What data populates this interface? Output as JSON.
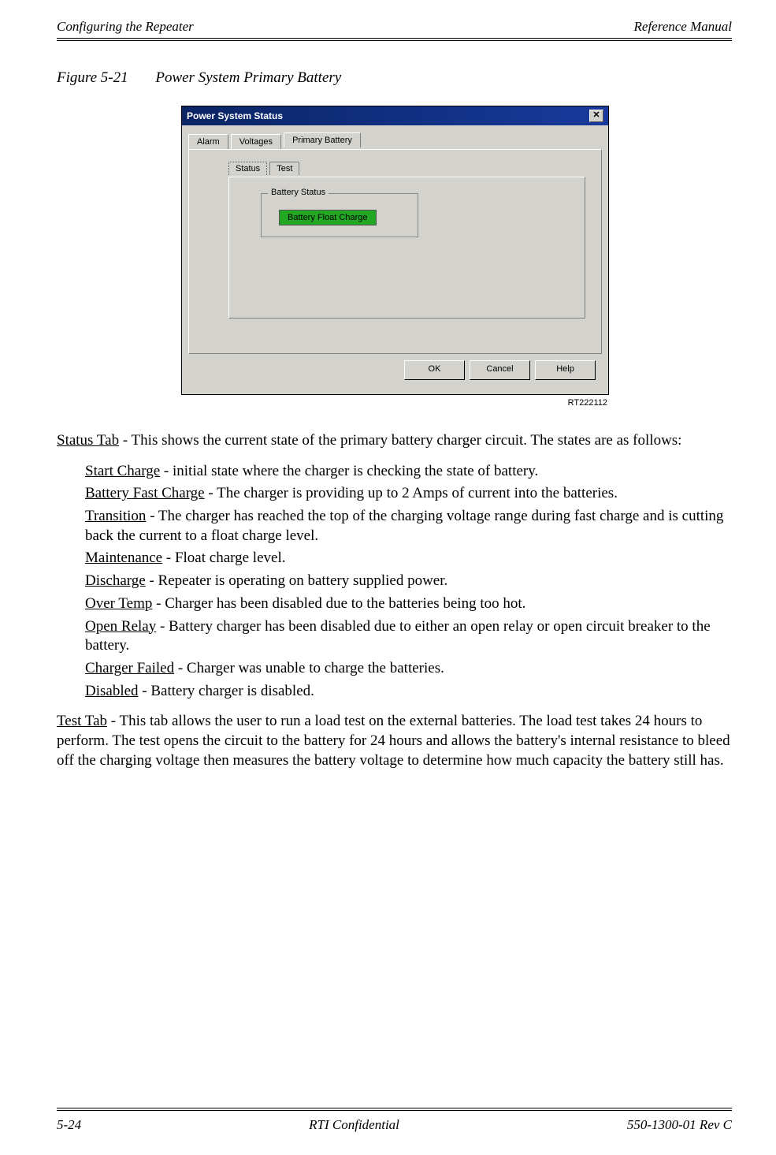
{
  "header": {
    "left": "Configuring the Repeater",
    "right": "Reference Manual"
  },
  "figure": {
    "number": "Figure 5-21",
    "title": "Power System Primary Battery",
    "rt_label": "RT222112"
  },
  "dialog": {
    "title": "Power System Status",
    "close_glyph": "✕",
    "main_tabs": {
      "alarm": "Alarm",
      "voltages": "Voltages",
      "primary_battery": "Primary Battery"
    },
    "sub_tabs": {
      "status": "Status",
      "test": "Test"
    },
    "group_label": "Battery Status",
    "status_value": "Battery Float Charge",
    "buttons": {
      "ok": "OK",
      "cancel": "Cancel",
      "help": "Help"
    }
  },
  "body": {
    "status_intro_label": "Status Tab",
    "status_intro_text": " - This shows the current state of the primary battery charger circuit. The states are as follows:",
    "states": [
      {
        "term": "Start Charge",
        "text": " - initial state where the charger is checking the state of battery."
      },
      {
        "term": "Battery Fast Charge",
        "text": " - The charger is providing up to 2 Amps of current into the batteries."
      },
      {
        "term": "Transition",
        "text": " - The charger has reached the top of the charging voltage range during fast charge and is cutting back the current to a float charge level."
      },
      {
        "term": "Maintenance",
        "text": " - Float charge level."
      },
      {
        "term": "Discharge",
        "text": " - Repeater is operating on battery supplied power."
      },
      {
        "term": "Over Temp",
        "text": " - Charger has been disabled due to the batteries being too hot."
      },
      {
        "term": "Open Relay",
        "text": " - Battery charger has been disabled due to either an open relay or open circuit breaker to the battery."
      },
      {
        "term": "Charger Failed",
        "text": " - Charger was unable to charge the batteries."
      },
      {
        "term": "Disabled",
        "text": " - Battery charger is disabled."
      }
    ],
    "test_intro_label": "Test Tab",
    "test_intro_text": " - This tab allows the user to run a load test on the external batteries. The load test takes 24 hours to perform. The test opens the circuit to the battery for 24 hours and allows the battery's internal resistance to bleed off the charging voltage then measures the battery voltage to determine how much capacity the battery still has."
  },
  "footer": {
    "left": "5-24",
    "center": "RTI Confidential",
    "right": "550-1300-01 Rev C"
  }
}
